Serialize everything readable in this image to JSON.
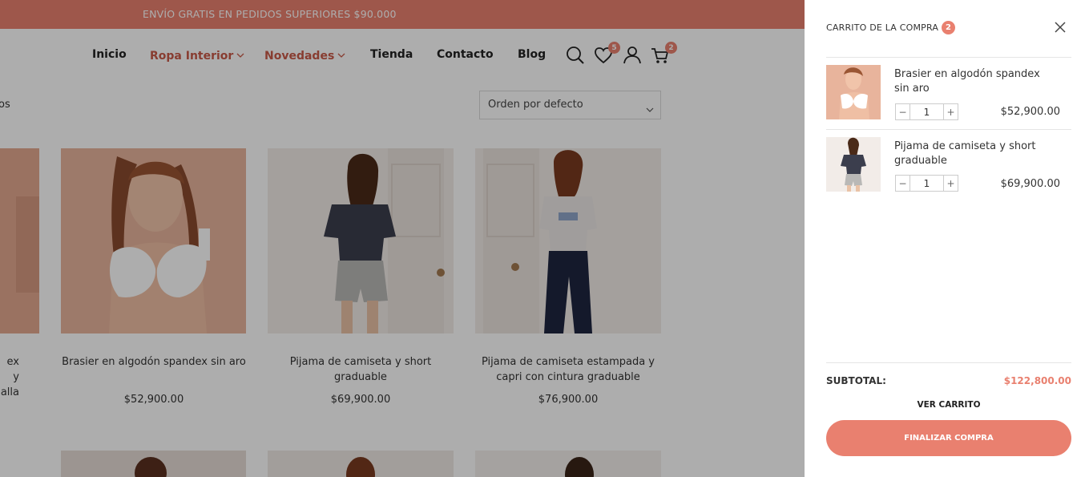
{
  "promo": {
    "text": "ENVÍO GRATIS EN PEDIDOS SUPERIORES $90.000"
  },
  "nav": {
    "items": [
      {
        "label": "Inicio"
      },
      {
        "label": "Ropa Interior"
      },
      {
        "label": "Novedades"
      },
      {
        "label": "Tienda"
      },
      {
        "label": "Contacto"
      },
      {
        "label": "Blog"
      }
    ]
  },
  "header_icons": {
    "wishlist_count": "5",
    "cart_count": "2"
  },
  "shop": {
    "results_text": "os",
    "sort_selected": "Orden por defecto",
    "partial_product_name": [
      "ex y",
      "alla"
    ],
    "products": [
      {
        "name": "Brasier en algodón spandex sin aro",
        "price": "$52,900.00"
      },
      {
        "name": "Pijama de camiseta y short graduable",
        "price": "$69,900.00"
      },
      {
        "name": "Pijama de camiseta estampada y capri con cintura graduable",
        "price": "$76,900.00"
      }
    ]
  },
  "cart": {
    "title": "CARRITO DE LA COMPRA",
    "count": "2",
    "items": [
      {
        "name": "Brasier en algodón spandex sin aro",
        "qty": "1",
        "price": "$52,900.00"
      },
      {
        "name": "Pijama de camiseta y short graduable",
        "qty": "1",
        "price": "$69,900.00"
      }
    ],
    "qty_minus": "−",
    "qty_plus": "+",
    "subtotal_label": "SUBTOTAL:",
    "subtotal_value": "$122,800.00",
    "view_cart_label": "VER CARRITO",
    "checkout_label": "FINALIZAR COMPRA"
  },
  "colors": {
    "accent": "#e9806f",
    "nav_accent": "#c95a49",
    "overlay": "rgba(0,0,0,0.32)"
  },
  "icons": [
    "search-icon",
    "heart-icon",
    "user-icon",
    "cart-icon",
    "close-icon",
    "chevron-down-icon"
  ]
}
